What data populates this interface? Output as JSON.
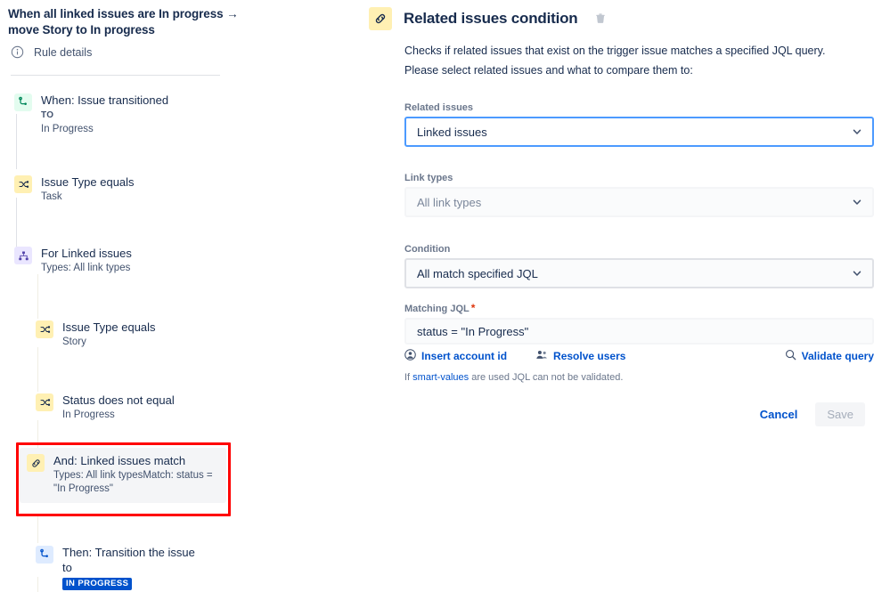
{
  "rule": {
    "title": "When all linked issues are In progress → move Story to In progress",
    "details_label": "Rule details"
  },
  "tree": [
    {
      "icon": "transition-icon",
      "icon_color": "green",
      "title": "When: Issue transitioned",
      "sub_caps": "TO",
      "sub": "In Progress",
      "indent": 0
    },
    {
      "icon": "condition-icon",
      "icon_color": "yellow",
      "title": "Issue Type equals",
      "sub": "Task",
      "indent": 0
    },
    {
      "icon": "branch-icon",
      "icon_color": "purple",
      "title": "For Linked issues",
      "sub": "Types: All link types",
      "indent": 0
    },
    {
      "icon": "condition-icon",
      "icon_color": "yellow",
      "title": "Issue Type equals",
      "sub": "Story",
      "indent": 1
    },
    {
      "icon": "condition-icon",
      "icon_color": "yellow",
      "title": "Status does not equal",
      "sub": "In Progress",
      "indent": 1
    }
  ],
  "selected_node": {
    "icon": "link-icon",
    "icon_color": "yellow",
    "title": "And: Linked issues match",
    "sub": "Types: All link typesMatch: status = \"In Progress\"",
    "highlight_color": "#ff0000"
  },
  "then_node": {
    "icon": "transition-icon",
    "icon_color": "blue",
    "title": "Then: Transition the issue to",
    "badge": "IN PROGRESS",
    "badge_color": "#0052cc"
  },
  "panel": {
    "title": "Related issues condition",
    "icon": "link-icon",
    "delete_icon": "trash-icon",
    "description_1": "Checks if related issues that exist on the trigger issue matches a specified JQL query.",
    "description_2": "Please select related issues and what to compare them to:",
    "fields": {
      "related_issues": {
        "label": "Related issues",
        "value": "Linked issues",
        "state": "focused"
      },
      "link_types": {
        "label": "Link types",
        "value": "All link types",
        "state": "disabled"
      },
      "condition": {
        "label": "Condition",
        "value": "All match specified JQL",
        "state": "normal"
      },
      "matching_jql": {
        "label": "Matching JQL",
        "required": "*",
        "value": "status = \"In Progress\""
      }
    },
    "jql_actions": {
      "insert_account_id": "Insert account id",
      "resolve_users": "Resolve users",
      "validate_query": "Validate query"
    },
    "hint": {
      "prefix": "If ",
      "link": "smart-values",
      "suffix": " are used JQL can not be validated."
    },
    "buttons": {
      "cancel": "Cancel",
      "save": "Save"
    }
  }
}
